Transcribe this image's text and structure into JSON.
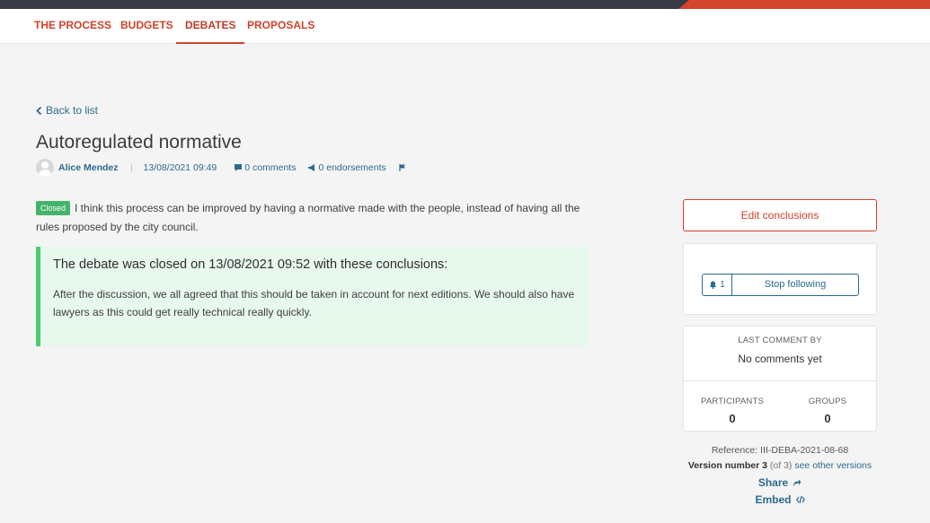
{
  "nav": {
    "tabs": [
      {
        "label": "THE PROCESS"
      },
      {
        "label": "BUDGETS"
      },
      {
        "label": "DEBATES"
      },
      {
        "label": "PROPOSALS"
      }
    ],
    "active_tab": "DEBATES"
  },
  "back_link": "Back to list",
  "debate": {
    "title": "Autoregulated normative",
    "author": "Alice Mendez",
    "date": "13/08/2021 09:49",
    "comments": "0 comments",
    "endorsements": "0 endorsements",
    "status_badge": "Closed",
    "description": "I think this process can be improved by having a normative made with the people, instead of having all the rules proposed by the city council."
  },
  "conclusions": {
    "heading": "The debate was closed on 13/08/2021 09:52 with these conclusions:",
    "text": "After the discussion, we all agreed that this should be taken in account for next editions. We should also have lawyers as this could get really technical really quickly."
  },
  "sidebar": {
    "edit_conclusions": "Edit conclusions",
    "follow_count": "1",
    "follow_label": "Stop following",
    "last_comment_label": "LAST COMMENT BY",
    "last_comment_value": "No comments yet",
    "participants_label": "PARTICIPANTS",
    "participants_value": "0",
    "groups_label": "GROUPS",
    "groups_value": "0",
    "reference": "Reference: III-DEBA-2021-08-68",
    "version_label": "Version number 3",
    "version_of": "(of 3)",
    "see_other_versions": "see other versions",
    "share": "Share",
    "embed": "Embed"
  },
  "colors": {
    "accent": "#d0422c",
    "link": "#2c6a8e",
    "success": "#4ccd71",
    "success_bg": "#e7f8ec"
  },
  "icons": [
    "chevron-left-icon",
    "avatar-icon",
    "comment-icon",
    "megaphone-icon",
    "flag-icon",
    "bell-icon",
    "share-arrow-icon",
    "code-icon"
  ]
}
